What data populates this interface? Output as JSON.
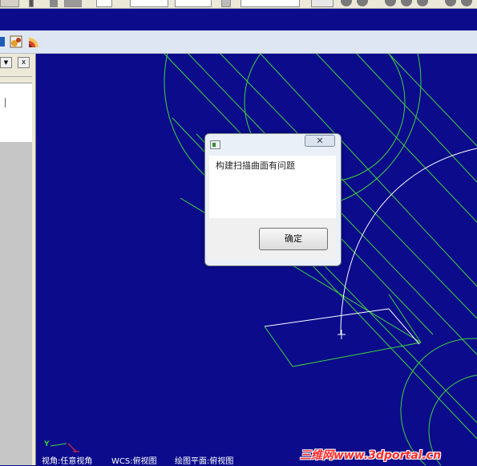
{
  "toolbar_top": {
    "dropdown_1": "",
    "dropdown_2": "",
    "dropdown_3": ""
  },
  "toolbar_2": {
    "icons": [
      "curve-icon",
      "image-icon",
      "fan-icon"
    ]
  },
  "left_panel": {
    "dropdown_glyph": "▼",
    "close_glyph": "x"
  },
  "dialog": {
    "close_glyph": "✕",
    "message": "构建扫描曲面有问题",
    "ok_label": "确定"
  },
  "status_bar": {
    "axis_y": "Y",
    "view_angle": "视角:任意视角",
    "wcs": "WCS:俯视图",
    "drawing_plane": "绘图平面:俯视图"
  },
  "watermark": "三维网www.3dportal.cn",
  "colors": {
    "background": "#0b0b8c",
    "geometry": "#3fd43f",
    "highlight": "#ffffff",
    "watermark": "#ff2a2a"
  }
}
